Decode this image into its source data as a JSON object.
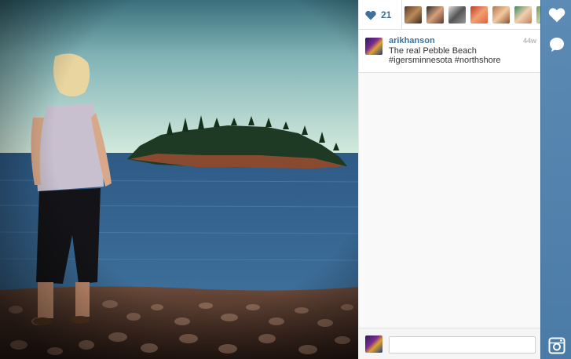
{
  "post": {
    "like_count": "21",
    "username": "arikhanson",
    "age": "44w",
    "caption_line1": "The real Pebble Beach",
    "caption_line2": "#igersminnesota #northshore"
  },
  "comment": {
    "value": ""
  },
  "icons": {
    "like": "heart-icon",
    "comment": "speech-bubble-icon",
    "app": "instagram-camera-icon"
  },
  "colors": {
    "accent": "#3f729b",
    "strip": "#4a7aa6"
  }
}
